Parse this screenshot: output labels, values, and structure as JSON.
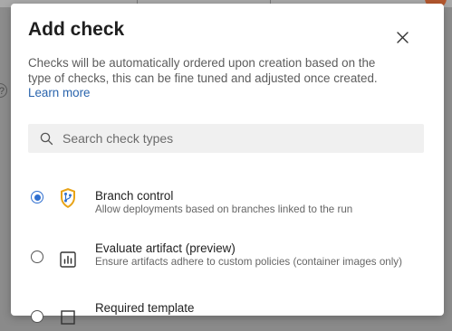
{
  "dialog": {
    "title": "Add check",
    "close_icon": "close-icon",
    "description": "Checks will be automatically ordered upon creation based on the type of checks, this can be fine tuned and adjusted once created.",
    "learn_more": "Learn more",
    "search": {
      "placeholder": "Search check types",
      "value": "",
      "icon": "search-icon"
    },
    "checks": [
      {
        "title": "Branch control",
        "description": "Allow deployments based on branches linked to the run",
        "selected": true,
        "icon": "branch-shield-icon"
      },
      {
        "title": "Evaluate artifact (preview)",
        "description": "Ensure artifacts adhere to custom policies (container images only)",
        "selected": false,
        "icon": "chart-icon"
      },
      {
        "title": "Required template",
        "description": "",
        "selected": false,
        "icon": "template-icon"
      }
    ]
  },
  "background": {
    "help_glyph": "?"
  },
  "colors": {
    "accent": "#2f6fd0",
    "link": "#2a64ad",
    "shield_yellow": "#e8a317",
    "shield_blue": "#2f6fd0"
  }
}
